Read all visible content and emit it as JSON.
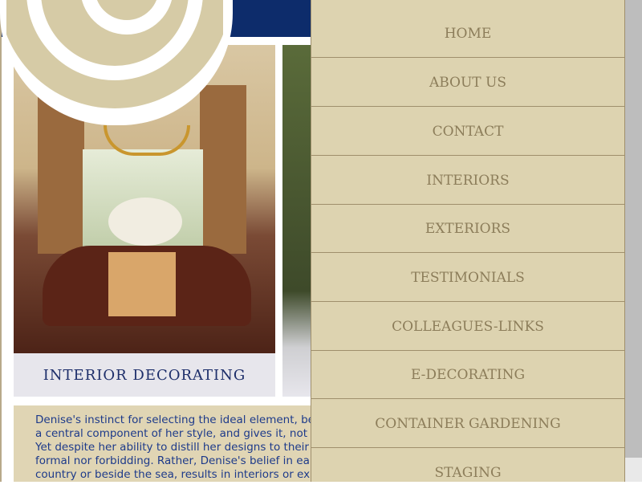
{
  "page": {
    "caption": "INTERIOR DECORATING",
    "body_lines": [
      "Denise's instinct for selecting the ideal element, be",
      "a central component of her style, and gives it, not",
      "Yet despite her ability to distill her designs to their",
      "formal nor forbidding. Rather, Denise's belief in ea",
      "country or beside the sea, results in interiors or ex"
    ],
    "colors": {
      "header": "#0d2c6b",
      "nav_bg": "#ddd3b0",
      "nav_text": "#8c7d5a",
      "text_box_bg": "#e0d5b4",
      "body_text": "#1d3a8a",
      "caption_text": "#1d2e6a",
      "logo_swirl": "#d6cba6"
    }
  },
  "nav": {
    "items": [
      {
        "label": "HOME"
      },
      {
        "label": "ABOUT US"
      },
      {
        "label": "CONTACT"
      },
      {
        "label": "INTERIORS"
      },
      {
        "label": "EXTERIORS"
      },
      {
        "label": "TESTIMONIALS"
      },
      {
        "label": "COLLEAGUES-LINKS"
      },
      {
        "label": "E-DECORATING"
      },
      {
        "label": "CONTAINER GARDENING"
      },
      {
        "label": "STAGING"
      }
    ]
  },
  "icons": {
    "logo": "spiral-logo-icon"
  }
}
